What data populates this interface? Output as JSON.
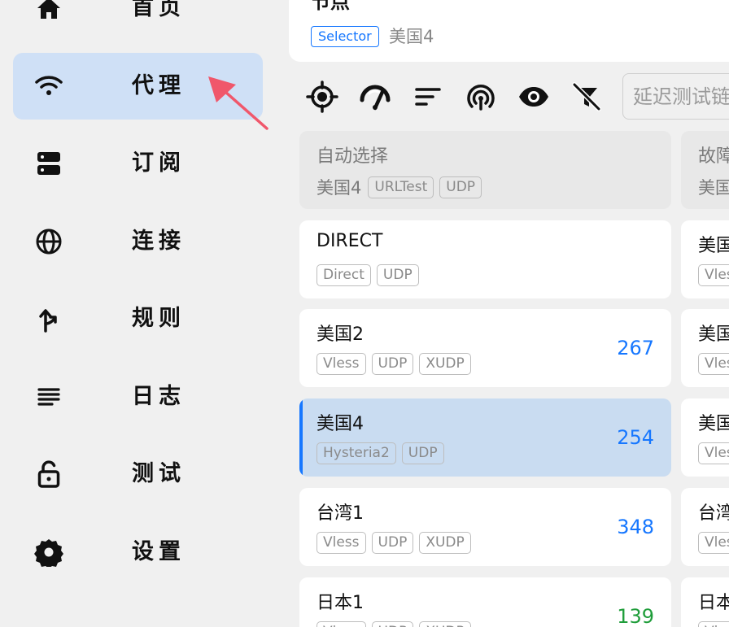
{
  "sidebar": {
    "items": [
      {
        "label": "首页",
        "icon": "home-icon",
        "active": false
      },
      {
        "label": "代理",
        "icon": "wifi-icon",
        "active": true
      },
      {
        "label": "订阅",
        "icon": "server-icon",
        "active": false
      },
      {
        "label": "连接",
        "icon": "globe-icon",
        "active": false
      },
      {
        "label": "规则",
        "icon": "fork-arrow-icon",
        "active": false
      },
      {
        "label": "日志",
        "icon": "lines-icon",
        "active": false
      },
      {
        "label": "测试",
        "icon": "lock-open-icon",
        "active": false
      },
      {
        "label": "设置",
        "icon": "gear-icon",
        "active": false
      }
    ]
  },
  "group": {
    "name": "节点",
    "type": "Selector",
    "now": "美国4"
  },
  "toolbar": {
    "icons": [
      "locate-icon",
      "speedometer-icon",
      "sort-icon",
      "radar-icon",
      "eye-icon",
      "filter-off-icon"
    ],
    "filter_placeholder": "延迟测试链接"
  },
  "colors": {
    "accent": "#1677ff",
    "selected_bg": "#c9dcf1",
    "nav_active_bg": "#cfe0f6",
    "delay_good": "#1f9d3a",
    "delay_normal": "#1677ff",
    "annotation_arrow": "#f0576b"
  },
  "proxies": [
    {
      "name": "自动选择",
      "sub": "美国4",
      "tags": [
        "URLTest",
        "UDP"
      ],
      "delay": "",
      "state": "disabled"
    },
    {
      "name": "故障",
      "sub": "美国",
      "tags": [],
      "delay": "",
      "state": "disabled"
    },
    {
      "name": "DIRECT",
      "sub": "",
      "tags": [
        "Direct",
        "UDP"
      ],
      "delay": "",
      "state": "normal"
    },
    {
      "name": "美国",
      "sub": "",
      "tags": [
        "Vless"
      ],
      "delay": "",
      "state": "normal"
    },
    {
      "name": "美国2",
      "sub": "",
      "tags": [
        "Vless",
        "UDP",
        "XUDP"
      ],
      "delay": "267",
      "state": "normal"
    },
    {
      "name": "美国",
      "sub": "",
      "tags": [
        "Vless"
      ],
      "delay": "",
      "state": "normal"
    },
    {
      "name": "美国4",
      "sub": "",
      "tags": [
        "Hysteria2",
        "UDP"
      ],
      "delay": "254",
      "state": "selected"
    },
    {
      "name": "美国",
      "sub": "",
      "tags": [
        "Vless"
      ],
      "delay": "",
      "state": "normal"
    },
    {
      "name": "台湾1",
      "sub": "",
      "tags": [
        "Vless",
        "UDP",
        "XUDP"
      ],
      "delay": "348",
      "state": "normal"
    },
    {
      "name": "台湾",
      "sub": "",
      "tags": [
        "Vless"
      ],
      "delay": "",
      "state": "normal"
    },
    {
      "name": "日本1",
      "sub": "",
      "tags": [
        "Vless",
        "UDP",
        "XUDP"
      ],
      "delay": "139",
      "state": "normal"
    },
    {
      "name": "日本",
      "sub": "",
      "tags": [
        "Vless"
      ],
      "delay": "",
      "state": "normal"
    }
  ]
}
